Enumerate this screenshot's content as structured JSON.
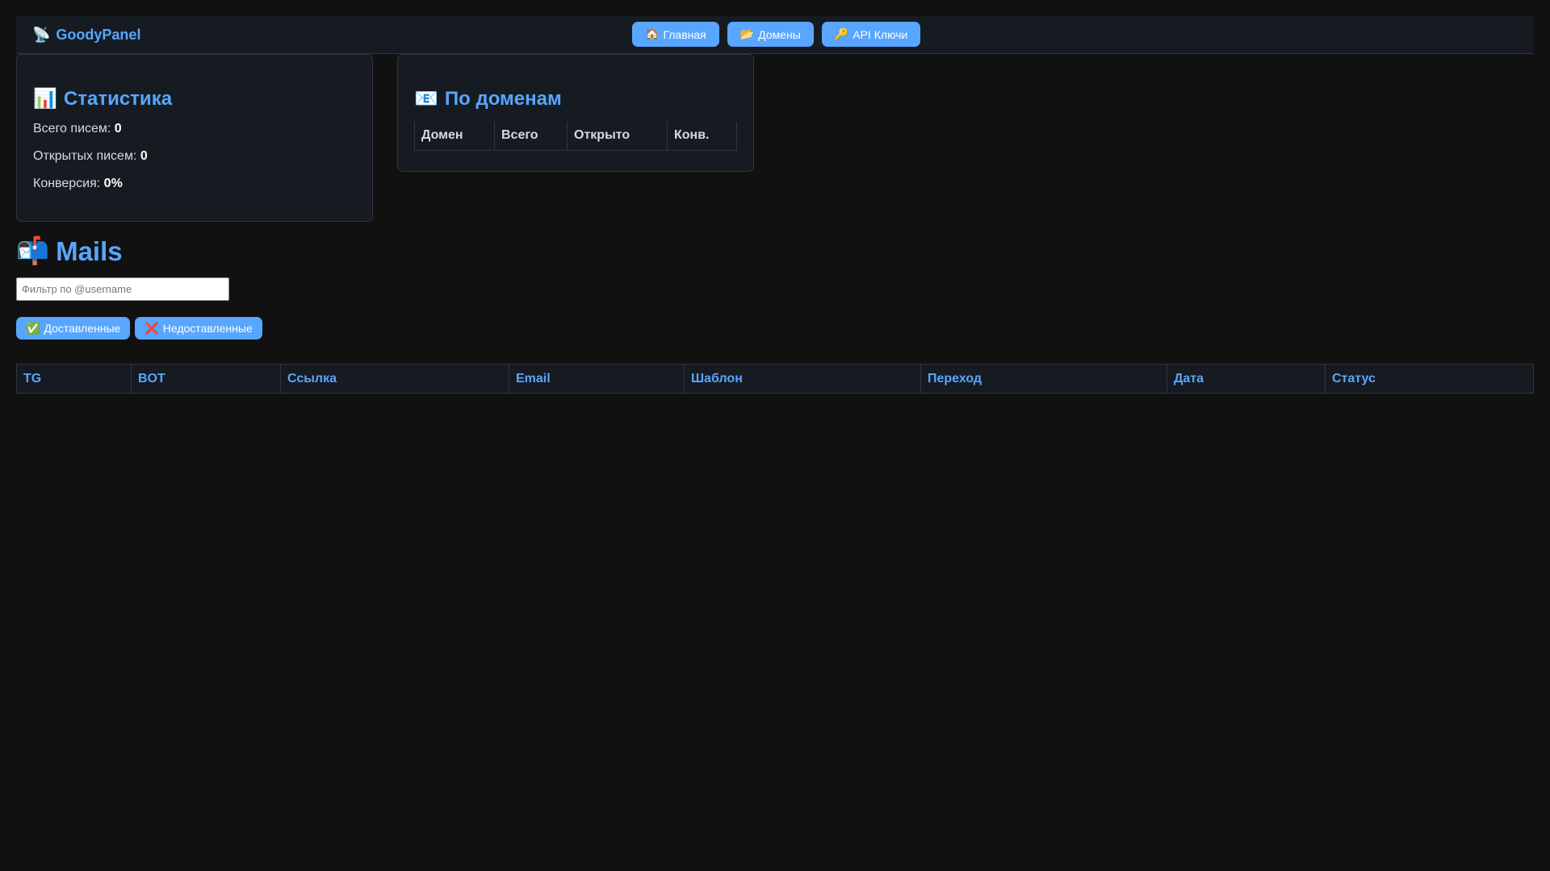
{
  "app": {
    "icon": "satellite-antenna-icon",
    "brand_glyph": "📡",
    "brand": "GoodyPanel"
  },
  "nav": [
    {
      "icon": "house-icon",
      "glyph": "🏠",
      "label": "Главная"
    },
    {
      "icon": "folder-open-icon",
      "glyph": "📂",
      "label": "Домены"
    },
    {
      "icon": "key-icon",
      "glyph": "🔑",
      "label": "API Ключи"
    }
  ],
  "stats": {
    "icon": "bar-chart-icon",
    "glyph": "📊",
    "title": "Статистика",
    "total_label": "Всего писем:",
    "total_value": "0",
    "opened_label": "Открытых писем:",
    "opened_value": "0",
    "conversion_label": "Конверсия:",
    "conversion_value": "0%"
  },
  "domains": {
    "icon": "email-icon",
    "glyph": "📧",
    "title": "По доменам",
    "columns": [
      "Домен",
      "Всего",
      "Открыто",
      "Конв."
    ]
  },
  "mails": {
    "icon": "mailbox-icon",
    "glyph": "📬",
    "title": "Mails",
    "filter_placeholder": "Фильтр по @username",
    "delivered_glyph": "✅",
    "delivered_label": "Доставленные",
    "undelivered_glyph": "❌",
    "undelivered_label": "Недоставленные",
    "columns": [
      "TG",
      "BOT",
      "Ссылка",
      "Email",
      "Шаблон",
      "Переход",
      "Дата",
      "Статус"
    ]
  },
  "colors": {
    "background": "#111111",
    "panel": "#161b22",
    "accent": "#58a6ff",
    "border": "#30363d"
  }
}
